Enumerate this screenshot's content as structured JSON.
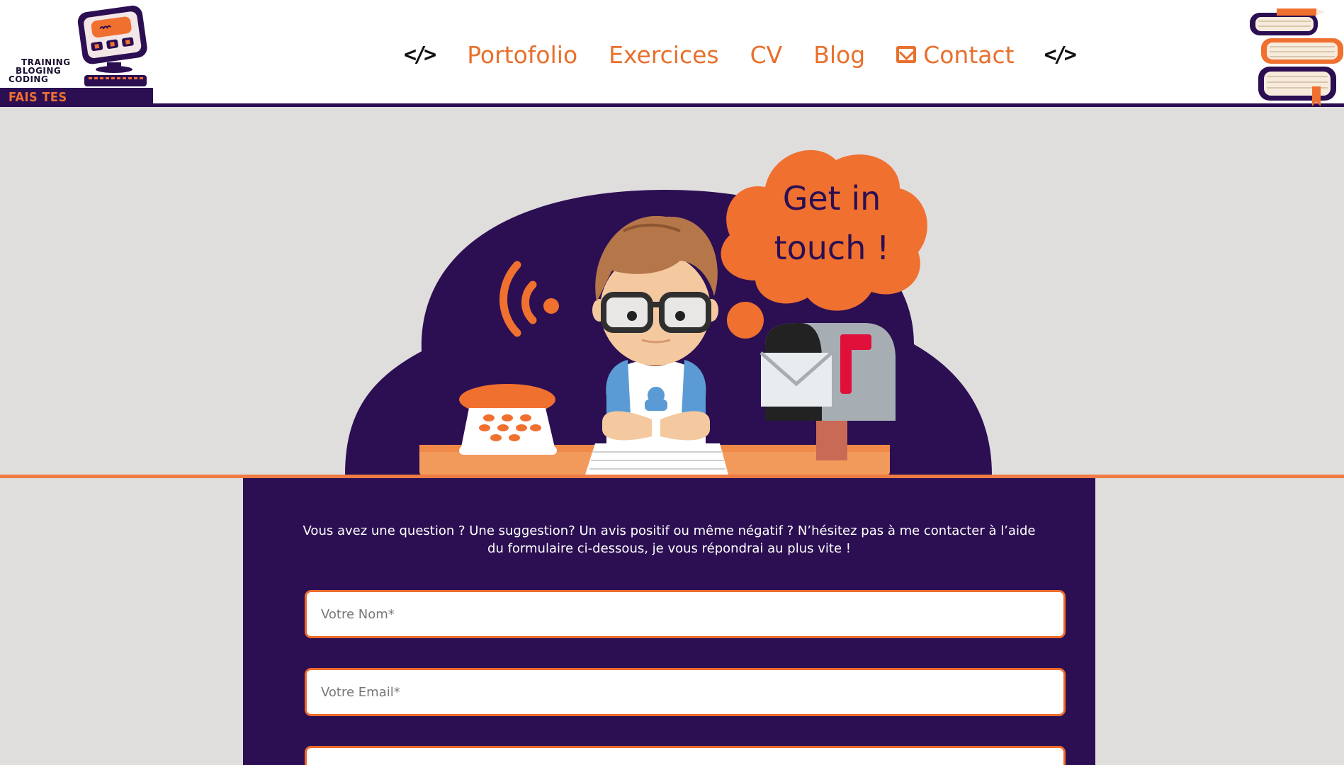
{
  "logo": {
    "lines": [
      "TRAINING",
      "BLOGING",
      "CODING"
    ],
    "tagline": "FAIS TES <DEV>OIRS!"
  },
  "nav": {
    "items": [
      {
        "label": "Portofolio"
      },
      {
        "label": "Exercices"
      },
      {
        "label": "CV"
      },
      {
        "label": "Blog"
      },
      {
        "label": "Contact",
        "icon": "envelope-icon"
      }
    ],
    "code_icon": "</>"
  },
  "hero": {
    "bubble_line1": "Get in",
    "bubble_line2": "touch !"
  },
  "contact": {
    "intro": "Vous avez une question ? Une suggestion? Un avis positif ou même négatif ? N’hésitez pas à me contacter à l’aide du formulaire ci-dessous, je vous répondrai au plus vite !",
    "name_placeholder": "Votre Nom*",
    "email_placeholder": "Votre Email*",
    "third_placeholder": ""
  },
  "colors": {
    "accent": "#e8702d",
    "dark_purple": "#2b0f52",
    "background": "#e0dddd"
  }
}
